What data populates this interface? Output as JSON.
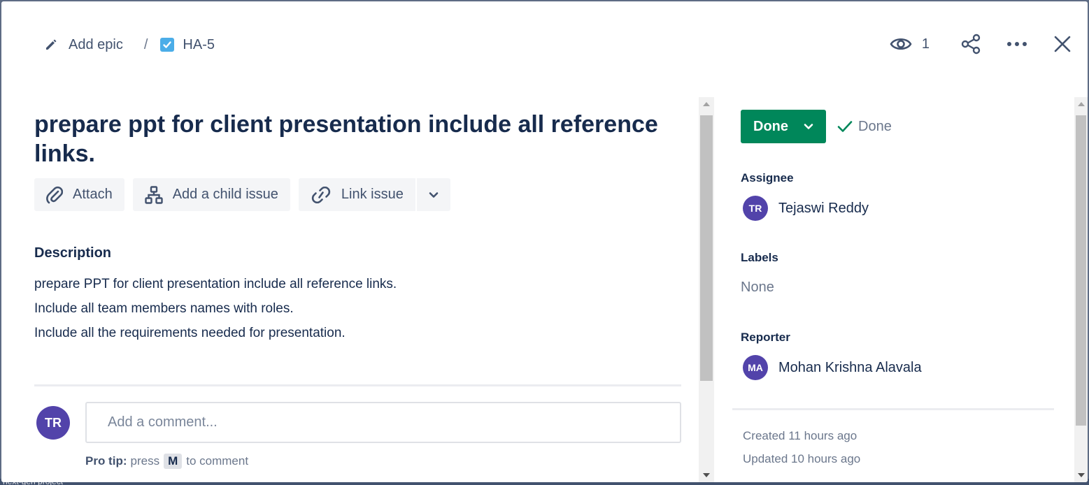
{
  "background": {
    "project_text": "next-gen project"
  },
  "breadcrumb": {
    "epic_icon": "pencil-icon",
    "epic_label": "Add epic",
    "separator": "/",
    "issue_icon": "checkbox-icon",
    "issue_key": "HA-5"
  },
  "header": {
    "watch_icon": "eye-icon",
    "watch_count": "1",
    "share_icon": "share-icon",
    "more_icon": "more-icon",
    "close_icon": "close-icon"
  },
  "issue": {
    "title": "prepare ppt for client presentation include all reference links.",
    "actions": {
      "attach": "Attach",
      "add_child": "Add a child issue",
      "link_issue": "Link issue"
    },
    "description_label": "Description",
    "description_lines": [
      "prepare PPT for client presentation include all reference links.",
      "Include all team members names with roles.",
      "Include all the requirements needed for presentation."
    ]
  },
  "comment": {
    "avatar_initials": "TR",
    "placeholder": "Add a comment...",
    "protip_bold": "Pro tip:",
    "protip_pre": "press",
    "protip_key": "M",
    "protip_post": "to comment"
  },
  "sidebar": {
    "status_label": "Done",
    "resolution_label": "Done",
    "assignee_label": "Assignee",
    "assignee_initials": "TR",
    "assignee_name": "Tejaswi Reddy",
    "labels_label": "Labels",
    "labels_value": "None",
    "reporter_label": "Reporter",
    "reporter_initials": "MA",
    "reporter_name": "Mohan Krishna Alavala",
    "created": "Created 11 hours ago",
    "updated": "Updated 10 hours ago"
  },
  "colors": {
    "status_done": "#00875a",
    "avatar": "#5243aa",
    "issue_type": "#4bade8",
    "text_primary": "#172b4d",
    "text_subtle": "#6b778c"
  }
}
